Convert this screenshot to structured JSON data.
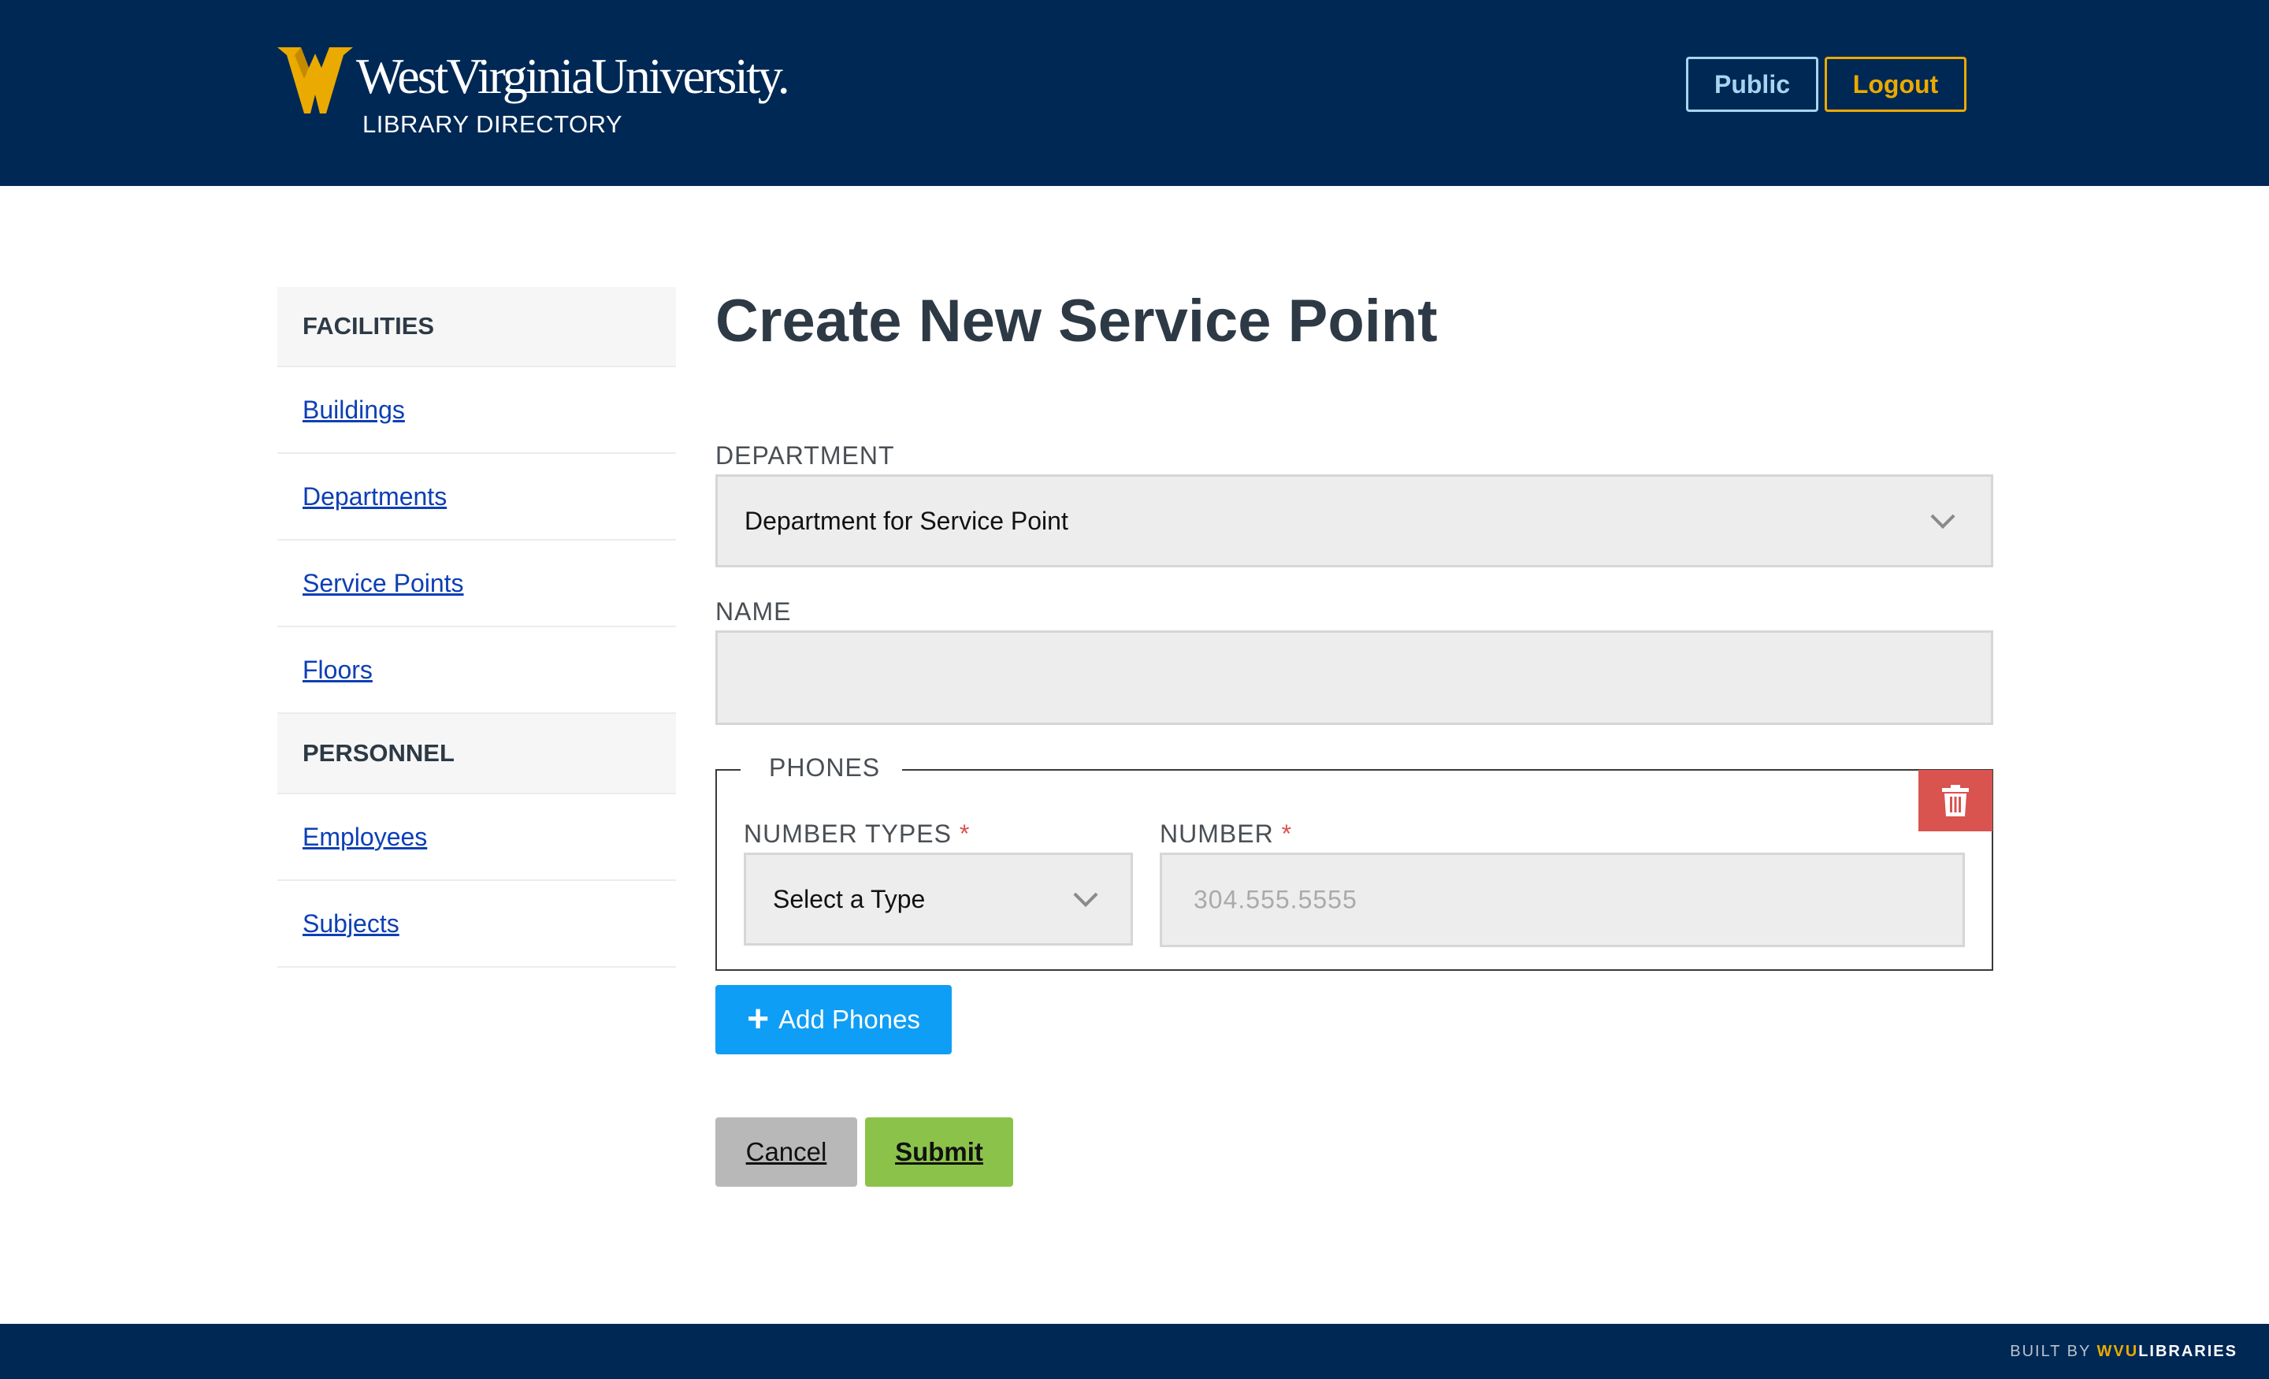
{
  "header": {
    "brand": "WestVirginiaUniversity.",
    "subtitle": "LIBRARY DIRECTORY",
    "public_label": "Public",
    "logout_label": "Logout",
    "brand_colors": {
      "navy": "#002855",
      "gold": "#eaaa00"
    }
  },
  "sidebar": {
    "sections": [
      {
        "title": "FACILITIES",
        "items": [
          "Buildings",
          "Departments",
          "Service Points",
          "Floors"
        ]
      },
      {
        "title": "PERSONNEL",
        "items": [
          "Employees",
          "Subjects"
        ]
      }
    ]
  },
  "main": {
    "title": "Create New Service Point",
    "department": {
      "label": "DEPARTMENT",
      "selected": "Department for Service Point"
    },
    "name": {
      "label": "NAME",
      "value": ""
    },
    "phones": {
      "legend": "PHONES",
      "number_types": {
        "label": "NUMBER TYPES",
        "required_mark": "*",
        "selected": "Select a Type"
      },
      "number": {
        "label": "NUMBER",
        "required_mark": "*",
        "placeholder": "304.555.5555"
      },
      "delete_icon": "trash-icon"
    },
    "add_phones_label": "Add Phones",
    "cancel_label": "Cancel",
    "submit_label": "Submit"
  },
  "footer": {
    "built_by": "BUILT BY",
    "brand_wvu": "WVU",
    "brand_libraries": "LIBRARIES"
  }
}
